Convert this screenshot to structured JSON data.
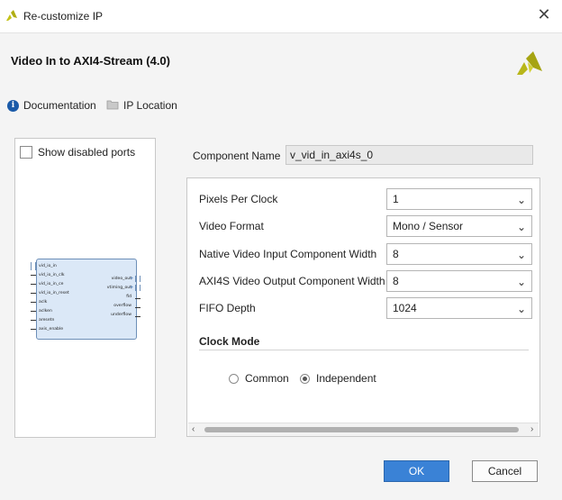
{
  "window": {
    "title": "Re-customize IP",
    "close_glyph": "✕"
  },
  "header": {
    "ip_title": "Video In to AXI4-Stream (4.0)"
  },
  "toolbar": {
    "documentation_label": "Documentation",
    "ip_location_label": "IP Location"
  },
  "left_panel": {
    "show_disabled_ports_label": "Show disabled ports",
    "block_left_pins": [
      "vid_io_in",
      "vid_io_in_clk",
      "vid_io_in_ce",
      "vid_io_in_reset",
      "aclk",
      "aclken",
      "aresetn",
      "axis_enable"
    ],
    "block_right_pins": [
      "video_out",
      "vtiming_out",
      "fid",
      "overflow",
      "underflow"
    ]
  },
  "component_name": {
    "label": "Component Name",
    "value": "v_vid_in_axi4s_0"
  },
  "params": {
    "pixels_per_clock": {
      "label": "Pixels Per Clock",
      "value": "1"
    },
    "video_format": {
      "label": "Video Format",
      "value": "Mono / Sensor"
    },
    "native_width": {
      "label": "Native Video Input Component Width",
      "value": "8"
    },
    "axi4s_width": {
      "label": "AXI4S Video Output Component Width",
      "value": "8"
    },
    "fifo_depth": {
      "label": "FIFO Depth",
      "value": "1024"
    },
    "clock_mode": {
      "title": "Clock Mode",
      "options": [
        "Common",
        "Independent"
      ],
      "selected": "Independent"
    }
  },
  "buttons": {
    "ok": "OK",
    "cancel": "Cancel"
  },
  "colors": {
    "accent": "#3a82d6",
    "logo_yellow": "#c4c21a",
    "info_blue": "#1a5aa8"
  }
}
